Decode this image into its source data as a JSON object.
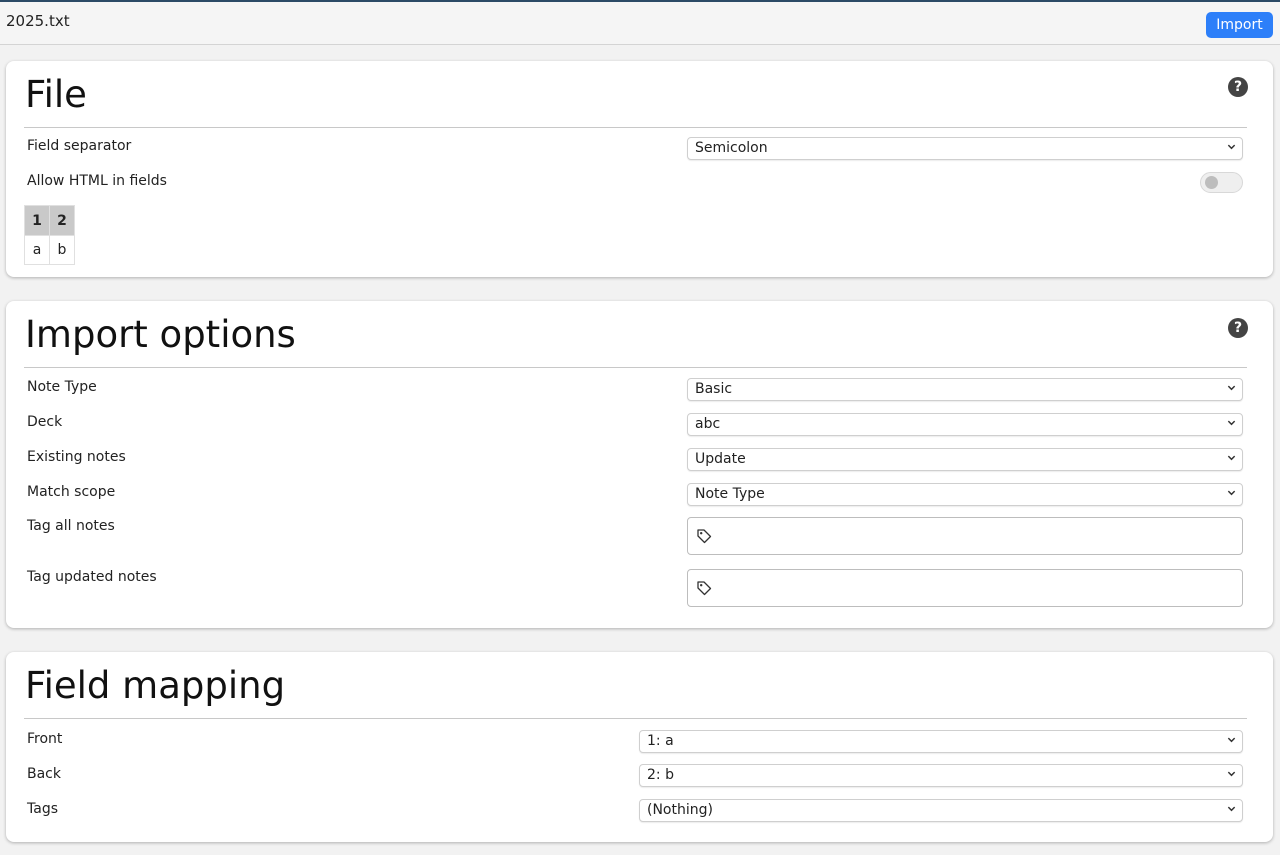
{
  "header": {
    "filename": "2025.txt",
    "import_label": "Import"
  },
  "file": {
    "title": "File",
    "field_separator_label": "Field separator",
    "field_separator_value": "Semicolon",
    "allow_html_label": "Allow HTML in fields",
    "allow_html_enabled": false,
    "preview_headers": [
      "1",
      "2"
    ],
    "preview_row": [
      "a",
      "b"
    ]
  },
  "import_options": {
    "title": "Import options",
    "note_type_label": "Note Type",
    "note_type_value": "Basic",
    "deck_label": "Deck",
    "deck_value": "abc",
    "existing_notes_label": "Existing notes",
    "existing_notes_value": "Update",
    "match_scope_label": "Match scope",
    "match_scope_value": "Note Type",
    "tag_all_label": "Tag all notes",
    "tag_updated_label": "Tag updated notes"
  },
  "field_mapping": {
    "title": "Field mapping",
    "rows": [
      {
        "label": "Front",
        "value": "1: a"
      },
      {
        "label": "Back",
        "value": "2: b"
      },
      {
        "label": "Tags",
        "value": "(Nothing)"
      }
    ]
  },
  "icons": {
    "help": "question-circle-icon",
    "tag": "tag-icon",
    "chevron": "chevron-down-icon"
  }
}
